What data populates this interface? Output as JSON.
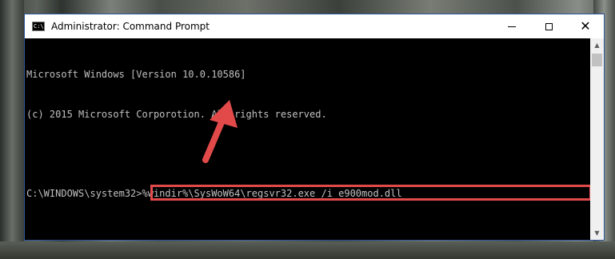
{
  "window": {
    "title": "Administrator: Command Prompt",
    "app_icon_text": "C:\\",
    "close_glyph": "✕"
  },
  "console": {
    "lines": [
      "Microsoft Windows [Version 10.0.10586]",
      "(c) 2015 Microsoft Corporotion. All rights reserved.",
      ""
    ],
    "prompt": "C:\\WINDOWS\\system32>",
    "command": "%windir%\\SysWoW64\\regsvr32.exe /i e900mod.dll"
  },
  "scrollbar": {
    "up_glyph": "▲",
    "down_glyph": "▼"
  },
  "annotation": {
    "highlight_color": "#e24a4a",
    "arrow_color": "#e24a4a"
  }
}
